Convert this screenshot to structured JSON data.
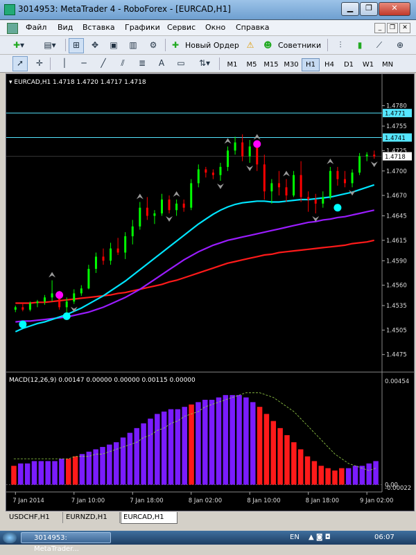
{
  "window": {
    "title": "3014953: MetaTrader 4 - RoboForex - [EURCAD,H1]"
  },
  "menu": [
    "Файл",
    "Вид",
    "Вставка",
    "Графики",
    "Сервис",
    "Окно",
    "Справка"
  ],
  "toolbar": {
    "new_order": "Новый Ордер",
    "experts": "Советники"
  },
  "timeframes": [
    "M1",
    "M5",
    "M15",
    "M30",
    "H1",
    "H4",
    "D1",
    "W1",
    "MN"
  ],
  "active_timeframe": "H1",
  "chart": {
    "symbol_info": "EURCAD,H1  1.4718 1.4720 1.4717 1.4718",
    "price_labels": [
      "1.4780",
      "1.4755",
      "1.4725",
      "1.4700",
      "1.4670",
      "1.4645",
      "1.4615",
      "1.4590",
      "1.4560",
      "1.4535",
      "1.4505",
      "1.4475"
    ],
    "hline_labels": [
      "1.4771",
      "1.4741"
    ],
    "current_price": "1.4718",
    "macd_label": "MACD(12,26,9) 0.00147 0.00000 0.00000 0.00115 0.00000",
    "macd_scale": [
      "0.00454",
      "0.00",
      "-0.00022"
    ],
    "time_labels": [
      "7 Jan 2014",
      "7 Jan 10:00",
      "7 Jan 18:00",
      "8 Jan 02:00",
      "8 Jan 10:00",
      "8 Jan 18:00",
      "9 Jan 02:00"
    ]
  },
  "tabs": [
    "USDCHF,H1",
    "EURNZD,H1",
    "EURCAD,H1"
  ],
  "active_tab": "EURCAD,H1",
  "taskbar": {
    "app_button": "3014953: MetaTrader...",
    "lang": "EN",
    "clock": "06:07"
  },
  "colors": {
    "bull": "#00ff00",
    "bear": "#ff0000",
    "ma_fast": "#00e5ff",
    "ma_mid": "#9a1cff",
    "ma_slow": "#ff1a1a",
    "hline": "#55e6ff",
    "macd_blue": "#7a1cff",
    "macd_red": "#ff1a1a",
    "signal_dot_buy": "#00ffff",
    "signal_dot_sell": "#ff00ff"
  },
  "chart_data": {
    "type": "candlestick",
    "price_axis": {
      "min": 1.4462,
      "max": 1.48
    },
    "horizontal_levels": [
      1.4771,
      1.4741
    ],
    "candles": [
      [
        1.453,
        1.4535,
        1.4527,
        1.4533
      ],
      [
        1.4533,
        1.4538,
        1.4528,
        1.453
      ],
      [
        1.453,
        1.454,
        1.4528,
        1.4538
      ],
      [
        1.4538,
        1.4542,
        1.4533,
        1.454
      ],
      [
        1.454,
        1.4548,
        1.4536,
        1.4545
      ],
      [
        1.4545,
        1.4566,
        1.454,
        1.455
      ],
      [
        1.455,
        1.4553,
        1.453,
        1.4533
      ],
      [
        1.4533,
        1.4545,
        1.4525,
        1.454
      ],
      [
        1.454,
        1.4555,
        1.4537,
        1.455
      ],
      [
        1.455,
        1.456,
        1.4547,
        1.4556
      ],
      [
        1.4556,
        1.4585,
        1.4555,
        1.458
      ],
      [
        1.458,
        1.46,
        1.4575,
        1.4595
      ],
      [
        1.4595,
        1.4605,
        1.4585,
        1.459
      ],
      [
        1.459,
        1.4612,
        1.4585,
        1.4605
      ],
      [
        1.4605,
        1.4618,
        1.4597,
        1.46
      ],
      [
        1.46,
        1.4625,
        1.4592,
        1.462
      ],
      [
        1.462,
        1.464,
        1.461,
        1.4632
      ],
      [
        1.4632,
        1.4662,
        1.4628,
        1.4655
      ],
      [
        1.4655,
        1.4668,
        1.464,
        1.4645
      ],
      [
        1.4645,
        1.4652,
        1.4635,
        1.4648
      ],
      [
        1.4648,
        1.4672,
        1.4645,
        1.4665
      ],
      [
        1.4665,
        1.467,
        1.4648,
        1.4652
      ],
      [
        1.4652,
        1.4665,
        1.4645,
        1.466
      ],
      [
        1.466,
        1.4665,
        1.465,
        1.4655
      ],
      [
        1.4655,
        1.469,
        1.4652,
        1.4685
      ],
      [
        1.4685,
        1.4708,
        1.468,
        1.4702
      ],
      [
        1.4702,
        1.4705,
        1.4692,
        1.4698
      ],
      [
        1.4698,
        1.4702,
        1.469,
        1.4695
      ],
      [
        1.4695,
        1.471,
        1.4688,
        1.4705
      ],
      [
        1.4705,
        1.473,
        1.47,
        1.4725
      ],
      [
        1.4725,
        1.4742,
        1.472,
        1.4735
      ],
      [
        1.4735,
        1.4745,
        1.4712,
        1.4718
      ],
      [
        1.4718,
        1.4738,
        1.471,
        1.473
      ],
      [
        1.473,
        1.4735,
        1.47,
        1.4708
      ],
      [
        1.4708,
        1.472,
        1.4665,
        1.4675
      ],
      [
        1.4675,
        1.469,
        1.466,
        1.4685
      ],
      [
        1.4685,
        1.47,
        1.467,
        1.468
      ],
      [
        1.468,
        1.469,
        1.4662,
        1.467
      ],
      [
        1.467,
        1.47,
        1.4668,
        1.4695
      ],
      [
        1.4695,
        1.4712,
        1.4662,
        1.4668
      ],
      [
        1.4668,
        1.4675,
        1.465,
        1.4665
      ],
      [
        1.4665,
        1.4672,
        1.4648,
        1.466
      ],
      [
        1.466,
        1.4675,
        1.4655,
        1.4668
      ],
      [
        1.4668,
        1.4705,
        1.4665,
        1.47
      ],
      [
        1.47,
        1.4705,
        1.4682,
        1.469
      ],
      [
        1.469,
        1.47,
        1.468,
        1.4685
      ],
      [
        1.4685,
        1.4702,
        1.468,
        1.4698
      ],
      [
        1.4698,
        1.4722,
        1.4695,
        1.4718
      ],
      [
        1.4718,
        1.4723,
        1.4712,
        1.472
      ],
      [
        1.472,
        1.4725,
        1.4715,
        1.4718
      ]
    ],
    "ma_fast": [
      1.4503,
      1.4507,
      1.451,
      1.4513,
      1.4515,
      1.4518,
      1.4521,
      1.4524,
      1.4528,
      1.4532,
      1.4537,
      1.4542,
      1.4547,
      1.4553,
      1.4559,
      1.4565,
      1.4572,
      1.4579,
      1.4586,
      1.4593,
      1.46,
      1.4607,
      1.4614,
      1.4621,
      1.4628,
      1.4635,
      1.4641,
      1.4647,
      1.4652,
      1.4656,
      1.4659,
      1.4661,
      1.4662,
      1.4663,
      1.4663,
      1.4662,
      1.4662,
      1.4663,
      1.4664,
      1.4665,
      1.4665,
      1.4666,
      1.4667,
      1.4668,
      1.467,
      1.4672,
      1.4674,
      1.4677,
      1.468,
      1.4683
    ],
    "ma_mid": [
      1.4515,
      1.4516,
      1.4516,
      1.4517,
      1.4518,
      1.4519,
      1.452,
      1.4521,
      1.4523,
      1.4525,
      1.4527,
      1.453,
      1.4533,
      1.4537,
      1.4541,
      1.4545,
      1.455,
      1.4555,
      1.4561,
      1.4567,
      1.4573,
      1.4579,
      1.4585,
      1.4591,
      1.4596,
      1.4601,
      1.4605,
      1.4609,
      1.4612,
      1.4615,
      1.4617,
      1.4619,
      1.4621,
      1.4623,
      1.4625,
      1.4627,
      1.4629,
      1.4631,
      1.4633,
      1.4635,
      1.4637,
      1.4638,
      1.464,
      1.4641,
      1.4643,
      1.4644,
      1.4646,
      1.4648,
      1.465,
      1.4652
    ],
    "ma_slow": [
      1.4538,
      1.4538,
      1.4538,
      1.4539,
      1.4539,
      1.454,
      1.4541,
      1.4542,
      1.4543,
      1.4544,
      1.4545,
      1.4546,
      1.4547,
      1.4548,
      1.455,
      1.4551,
      1.4553,
      1.4555,
      1.4557,
      1.4559,
      1.4561,
      1.4564,
      1.4566,
      1.4569,
      1.4572,
      1.4575,
      1.4578,
      1.4581,
      1.4584,
      1.4587,
      1.4589,
      1.4591,
      1.4593,
      1.4595,
      1.4597,
      1.4598,
      1.46,
      1.4601,
      1.4602,
      1.4603,
      1.4604,
      1.4605,
      1.4606,
      1.4607,
      1.4608,
      1.4609,
      1.4611,
      1.4612,
      1.4613,
      1.4615
    ],
    "arrows_up": [
      5,
      17,
      22,
      29,
      33,
      37,
      43
    ],
    "arrows_down": [
      8,
      21,
      28,
      32,
      41,
      46,
      49
    ],
    "dots": [
      {
        "i": 1,
        "p": 1.4512,
        "c": "buy"
      },
      {
        "i": 7,
        "p": 1.4522,
        "c": "buy"
      },
      {
        "i": 6,
        "p": 1.4548,
        "c": "sell"
      },
      {
        "i": 33,
        "p": 1.4733,
        "c": "sell"
      },
      {
        "i": 44,
        "p": 1.4655,
        "c": "buy"
      }
    ],
    "macd_axis": {
      "min": -0.00022,
      "max": 0.00454
    },
    "macd_hist": [
      0.0008,
      0.0009,
      0.0009,
      0.001,
      0.001,
      0.001,
      0.001,
      0.0011,
      0.0011,
      0.0012,
      0.0013,
      0.0014,
      0.0015,
      0.0016,
      0.0017,
      0.0018,
      0.002,
      0.0022,
      0.0024,
      0.0026,
      0.0028,
      0.003,
      0.0031,
      0.0032,
      0.0032,
      0.0033,
      0.0034,
      0.0035,
      0.0036,
      0.0036,
      0.0037,
      0.0038,
      0.0038,
      0.0038,
      0.0037,
      0.0035,
      0.0033,
      0.003,
      0.0027,
      0.0024,
      0.0021,
      0.0018,
      0.0015,
      0.0012,
      0.001,
      0.0008,
      0.0007,
      0.0006,
      0.0007,
      0.0007,
      0.0008,
      0.0008,
      0.0009,
      0.001
    ],
    "macd_hist_colors": [
      "r",
      "b",
      "b",
      "b",
      "b",
      "b",
      "b",
      "b",
      "r",
      "r",
      "b",
      "b",
      "b",
      "b",
      "b",
      "b",
      "b",
      "b",
      "b",
      "b",
      "b",
      "b",
      "b",
      "b",
      "b",
      "b",
      "r",
      "b",
      "b",
      "b",
      "b",
      "b",
      "b",
      "b",
      "b",
      "b",
      "r",
      "r",
      "r",
      "r",
      "r",
      "r",
      "r",
      "r",
      "r",
      "r",
      "r",
      "r",
      "r",
      "b",
      "b",
      "b",
      "b",
      "b"
    ],
    "macd_signal": [
      0.0011,
      0.0011,
      0.0011,
      0.0011,
      0.0011,
      0.0011,
      0.0011,
      0.0011,
      0.0011,
      0.0012,
      0.0012,
      0.0012,
      0.0013,
      0.0013,
      0.0014,
      0.0015,
      0.0016,
      0.0017,
      0.0018,
      0.002,
      0.0021,
      0.0023,
      0.0024,
      0.0026,
      0.0027,
      0.0029,
      0.003,
      0.0031,
      0.0033,
      0.0034,
      0.0035,
      0.0036,
      0.0037,
      0.0038,
      0.0039,
      0.0039,
      0.0039,
      0.0038,
      0.0037,
      0.0035,
      0.0033,
      0.0031,
      0.0028,
      0.0025,
      0.0022,
      0.0019,
      0.0016,
      0.0013,
      0.0011,
      0.0009,
      0.0008,
      0.0007,
      0.0006,
      0.0007
    ]
  }
}
